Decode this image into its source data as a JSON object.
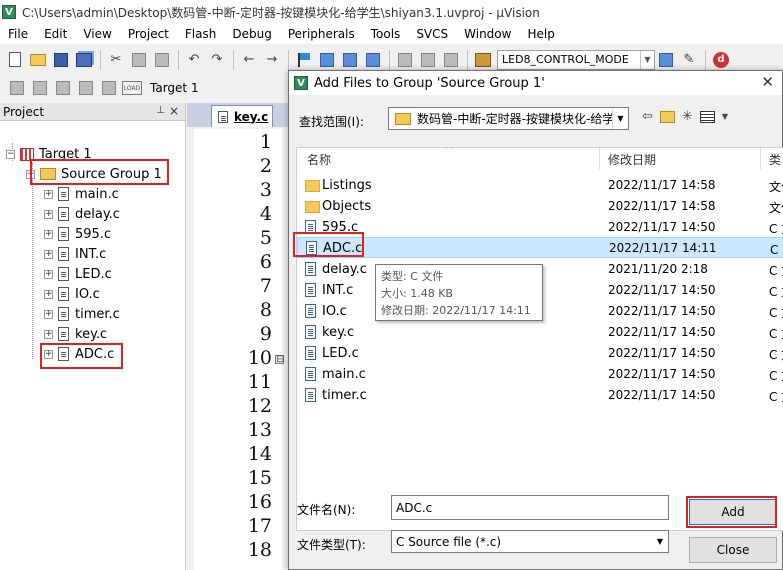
{
  "window": {
    "title": "C:\\Users\\admin\\Desktop\\数码管-中断-定时器-按键模块化-给学生\\shiyan3.1.uvproj - µVision",
    "icon_letter": "V"
  },
  "menu": [
    "File",
    "Edit",
    "View",
    "Project",
    "Flash",
    "Debug",
    "Peripherals",
    "Tools",
    "SVCS",
    "Window",
    "Help"
  ],
  "toolbar": {
    "mode_select": "LED8_CONTROL_MODE",
    "load_label": "LOAD",
    "target": "Target 1"
  },
  "project": {
    "title": "Project",
    "target": "Target 1",
    "group": "Source Group 1",
    "files": [
      "main.c",
      "delay.c",
      "595.c",
      "INT.c",
      "LED.c",
      "IO.c",
      "timer.c",
      "key.c",
      "ADC.c"
    ]
  },
  "editor": {
    "tab": "key.c",
    "lines": [
      "1",
      "2",
      "3",
      "4",
      "5",
      "6",
      "7",
      "8",
      "9",
      "10",
      "11",
      "12",
      "13",
      "14",
      "15",
      "16",
      "17",
      "18"
    ],
    "fold_marker": "⊟"
  },
  "dialog": {
    "title": "Add Files to Group 'Source Group 1'",
    "look_in_label": "查找范围(I):",
    "look_in_value": "数码管-中断-定时器-按键模块化-给学",
    "columns": {
      "name": "名称",
      "date": "修改日期",
      "type": "类"
    },
    "files": [
      {
        "name": "Listings",
        "date": "2022/11/17 14:58",
        "type": "文件",
        "kind": "folder"
      },
      {
        "name": "Objects",
        "date": "2022/11/17 14:58",
        "type": "文件",
        "kind": "folder"
      },
      {
        "name": "595.c",
        "date": "2022/11/17 14:50",
        "type": "C 文",
        "kind": "c"
      },
      {
        "name": "ADC.c",
        "date": "2022/11/17 14:11",
        "type": "C 文",
        "kind": "c",
        "selected": true
      },
      {
        "name": "delay.c",
        "date": "2021/11/20 2:18",
        "type": "C 文",
        "kind": "c"
      },
      {
        "name": "INT.c",
        "date": "2022/11/17 14:50",
        "type": "C 文",
        "kind": "c"
      },
      {
        "name": "IO.c",
        "date": "2022/11/17 14:50",
        "type": "C 文",
        "kind": "c"
      },
      {
        "name": "key.c",
        "date": "2022/11/17 14:50",
        "type": "C 文",
        "kind": "c"
      },
      {
        "name": "LED.c",
        "date": "2022/11/17 14:50",
        "type": "C 文",
        "kind": "c"
      },
      {
        "name": "main.c",
        "date": "2022/11/17 14:50",
        "type": "C 文",
        "kind": "c"
      },
      {
        "name": "timer.c",
        "date": "2022/11/17 14:50",
        "type": "C 文",
        "kind": "c"
      }
    ],
    "tooltip": {
      "type": "类型: C 文件",
      "size": "大小: 1.48 KB",
      "modified": "修改日期: 2022/11/17 14:11"
    },
    "filename_label": "文件名(N):",
    "filename_value": "ADC.c",
    "filetype_label": "文件类型(T):",
    "filetype_value": "C Source file (*.c)",
    "add_label": "Add",
    "close_label": "Close"
  },
  "colors": {
    "highlight": "#e02020",
    "selection": "#cce8ff",
    "accent": "#0078d7"
  }
}
